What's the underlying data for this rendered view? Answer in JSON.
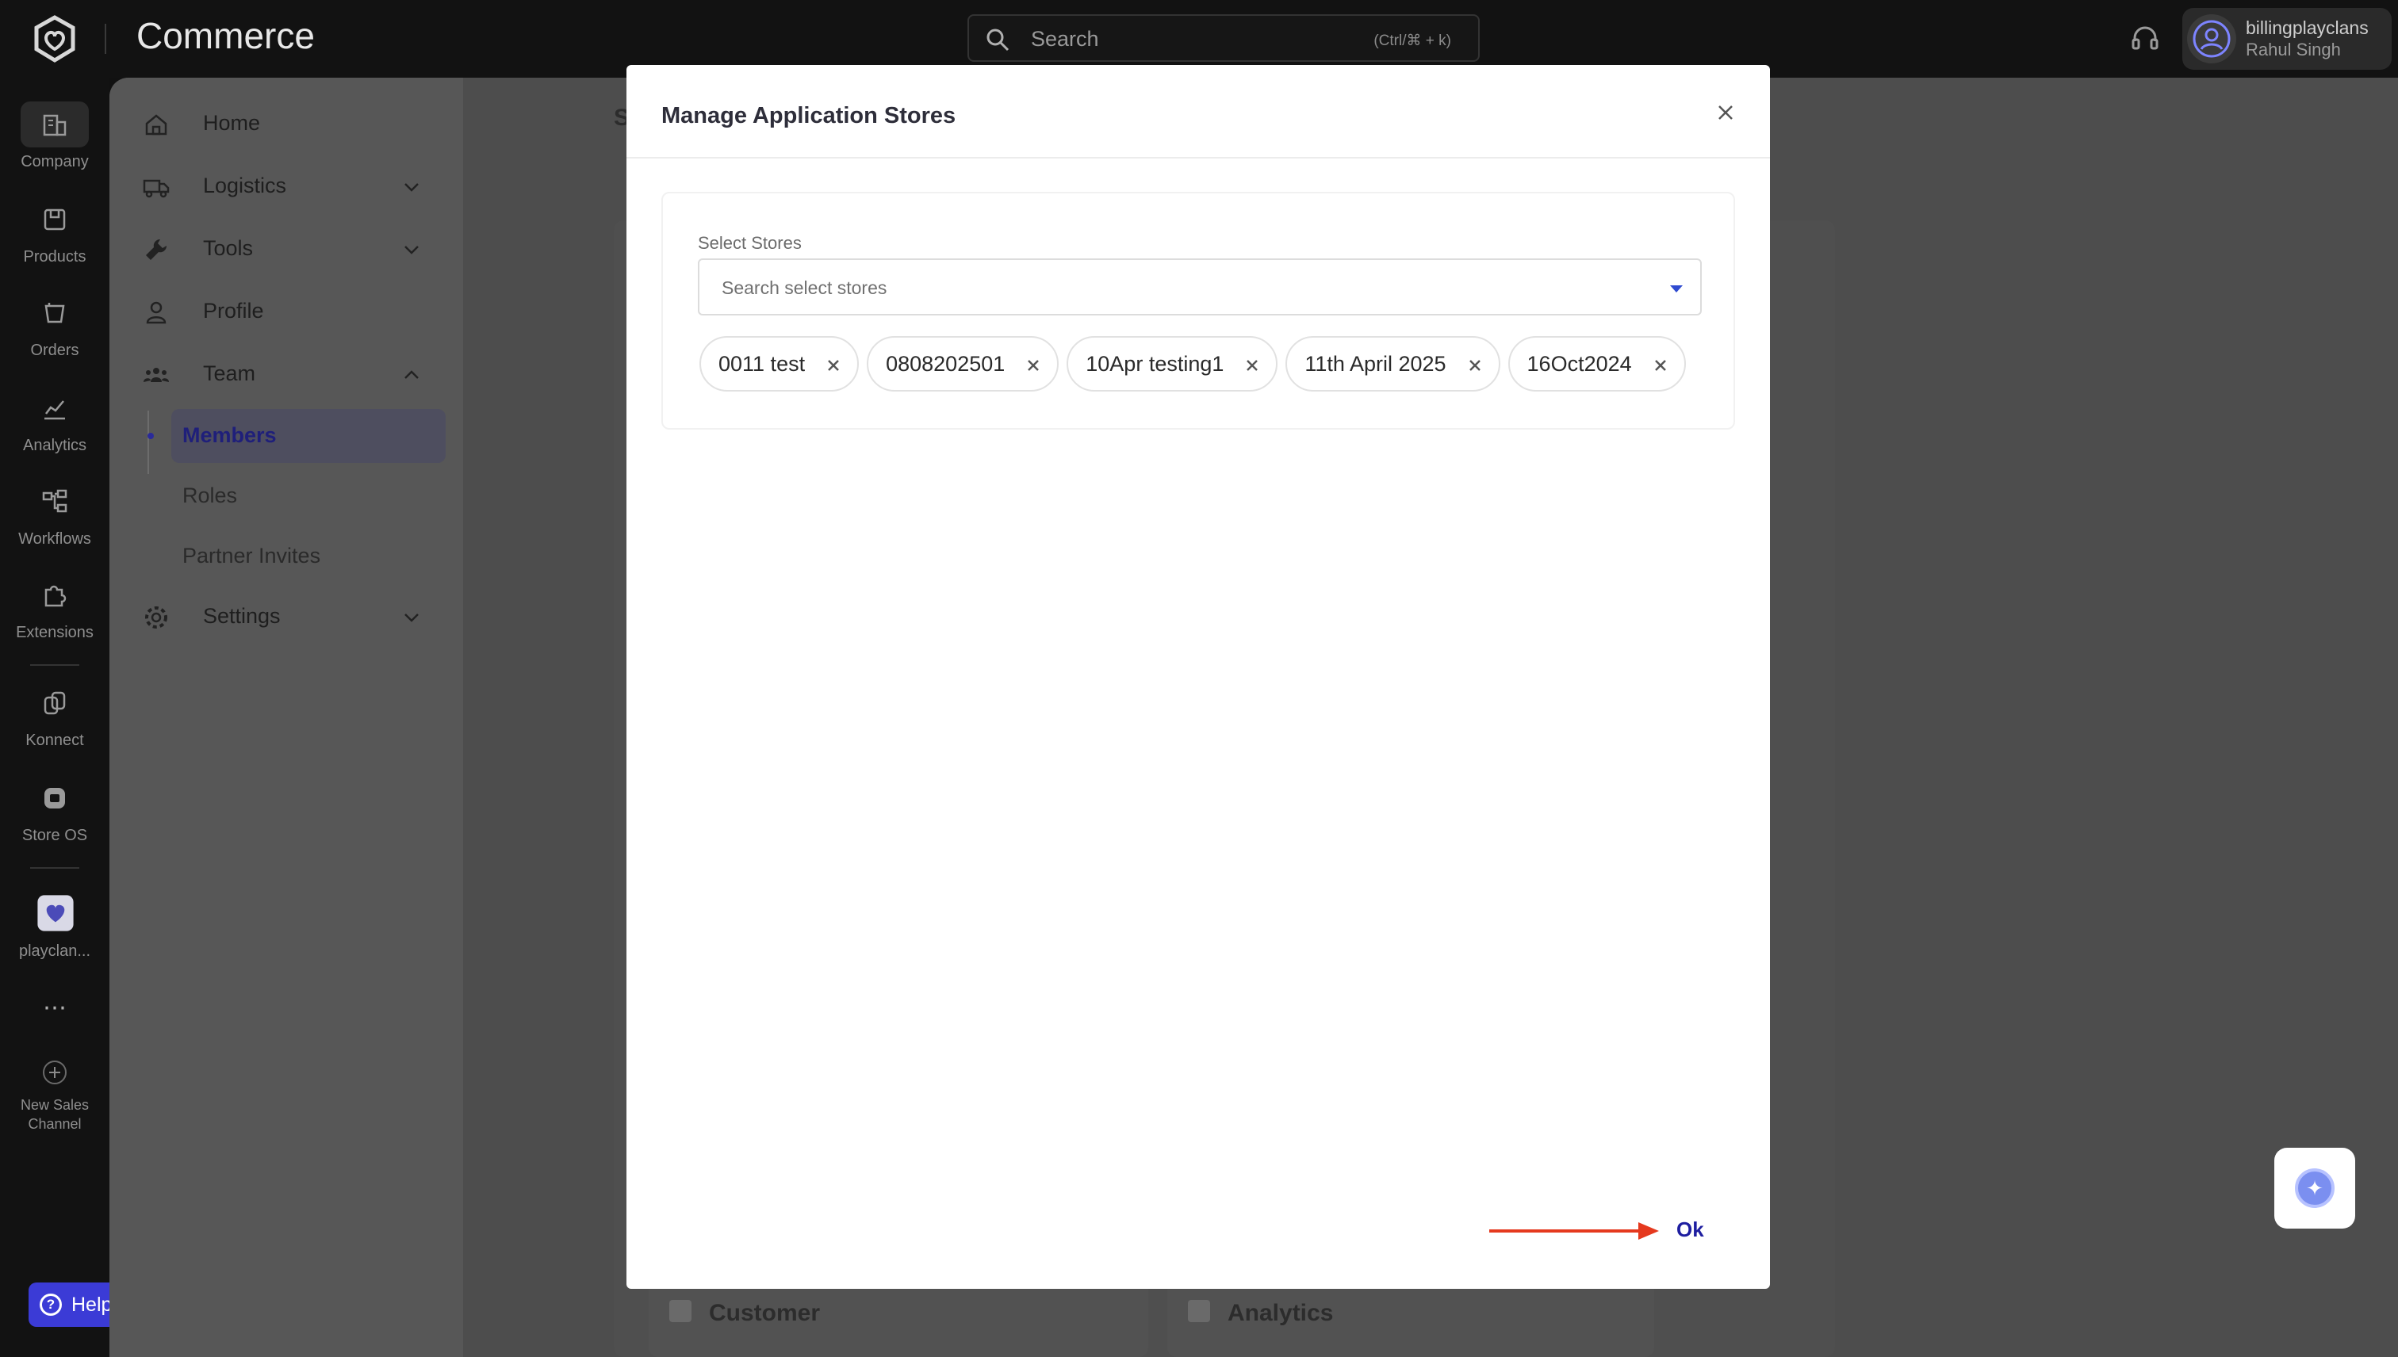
{
  "header": {
    "brand": "Commerce",
    "search_placeholder": "Search",
    "search_hint": "(Ctrl/⌘ + k)",
    "user_name": "billingplayclans",
    "user_sub": "Rahul Singh"
  },
  "rail": {
    "items": [
      {
        "label": "Company",
        "icon": "building-icon"
      },
      {
        "label": "Products",
        "icon": "box-icon"
      },
      {
        "label": "Orders",
        "icon": "cart-icon"
      },
      {
        "label": "Analytics",
        "icon": "chart-icon"
      },
      {
        "label": "Workflows",
        "icon": "flow-icon"
      },
      {
        "label": "Extensions",
        "icon": "puzzle-icon"
      },
      {
        "label": "Konnect",
        "icon": "konnect-icon"
      },
      {
        "label": "Store OS",
        "icon": "storeos-icon"
      },
      {
        "label": "playclan...",
        "icon": "app-icon"
      },
      {
        "label": "New Sales Channel",
        "icon": "plus-icon"
      }
    ],
    "more": "⋯",
    "help": "Help!"
  },
  "nav": {
    "home": "Home",
    "logistics": "Logistics",
    "tools": "Tools",
    "profile": "Profile",
    "team": "Team",
    "members": "Members",
    "roles": "Roles",
    "partner_invites": "Partner Invites",
    "settings": "Settings"
  },
  "background": {
    "title_fragment": "S",
    "card1": "Customer",
    "card2": "Analytics"
  },
  "modal": {
    "title": "Manage Application Stores",
    "field_label": "Select Stores",
    "field_placeholder": "Search select stores",
    "chips": [
      "0011 test",
      "0808202501",
      "10Apr testing1",
      "11th April 2025",
      "16Oct2024"
    ],
    "ok": "Ok",
    "arrow_color": "#e5391e"
  },
  "colors": {
    "accent": "#1e1ea0",
    "help": "#3b3bd6"
  }
}
